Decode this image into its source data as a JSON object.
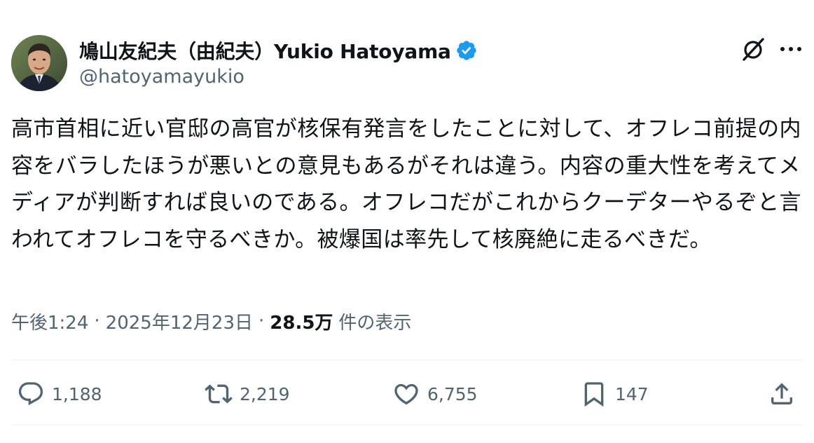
{
  "author": {
    "display_name": "鳩山友紀夫（由紀夫）Yukio Hatoyama",
    "handle": "@hatoyamayukio",
    "verified": true,
    "verified_color": "#1d9bf0"
  },
  "header_icons": {
    "grok": "grok-icon",
    "more": "more-options-icon"
  },
  "tweet": {
    "text": "高市首相に近い官邸の高官が核保有発言をしたことに対して、オフレコ前提の内容をバラしたほうが悪いとの意見もあるがそれは違う。内容の重大性を考えてメディアが判断すれば良いのである。オフレコだがこれからクーデターやるぞと言われてオフレコを守るべきか。被爆国は率先して核廃絶に走るべきだ。"
  },
  "meta": {
    "time": "午後1:24",
    "separator": "·",
    "date": "2025年12月23日",
    "views_count": "28.5万",
    "views_label": "件の表示"
  },
  "actions": {
    "replies": "1,188",
    "reposts": "2,219",
    "likes": "6,755",
    "bookmarks": "147"
  },
  "colors": {
    "text_primary": "#0f1419",
    "text_secondary": "#536471",
    "divider": "#eff3f4",
    "verified": "#1d9bf0"
  }
}
